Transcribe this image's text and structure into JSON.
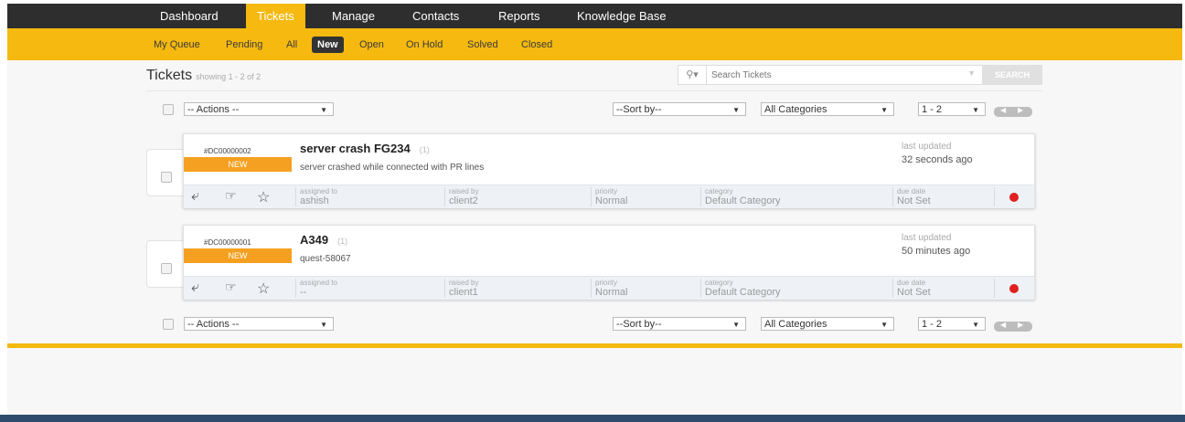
{
  "topnav": {
    "tabs": [
      {
        "label": "Dashboard"
      },
      {
        "label": "Tickets"
      },
      {
        "label": "Manage"
      },
      {
        "label": "Contacts"
      },
      {
        "label": "Reports"
      },
      {
        "label": "Knowledge Base"
      }
    ],
    "active": "Tickets"
  },
  "subnav": {
    "items": [
      {
        "label": "My Queue"
      },
      {
        "label": "Pending"
      },
      {
        "label": "All"
      },
      {
        "label": "New"
      },
      {
        "label": "Open"
      },
      {
        "label": "On Hold"
      },
      {
        "label": "Solved"
      },
      {
        "label": "Closed"
      }
    ],
    "active": "New"
  },
  "header": {
    "title": "Tickets",
    "subtitle": "showing 1 - 2 of 2"
  },
  "search": {
    "placeholder": "Search Tickets",
    "button": "SEARCH"
  },
  "toolbar": {
    "actions": "-- Actions --",
    "sort": "--Sort by--",
    "category": "All Categories",
    "range": "1 - 2"
  },
  "tickets": [
    {
      "id": "#DC00000002",
      "status": "NEW",
      "subject": "server crash FG234",
      "count": "(1)",
      "description": "server crashed while connected with PR lines",
      "last_updated_label": "last updated",
      "last_updated": "32 seconds ago",
      "assigned_label": "assigned to",
      "assigned": "ashish",
      "raised_label": "raised by",
      "raised": "client2",
      "priority_label": "priority",
      "priority": "Normal",
      "category_label": "category",
      "category": "Default Category",
      "due_label": "due date",
      "due": "Not Set"
    },
    {
      "id": "#DC00000001",
      "status": "NEW",
      "subject": "A349",
      "count": "(1)",
      "description": "quest-58067",
      "last_updated_label": "last updated",
      "last_updated": "50 minutes ago",
      "assigned_label": "assigned to",
      "assigned": "--",
      "raised_label": "raised by",
      "raised": "client1",
      "priority_label": "priority",
      "priority": "Normal",
      "category_label": "category",
      "category": "Default Category",
      "due_label": "due date",
      "due": "Not Set"
    }
  ],
  "icons": {
    "search": "search-icon",
    "reply": "reply-icon",
    "assign": "assign-hand-icon",
    "star": "star-icon",
    "status_dot": "status-dot-icon"
  },
  "colors": {
    "nav_bg": "#2e2e2e",
    "accent": "#f5b910",
    "badge_new": "#f5a020",
    "status_dot": "#e02020"
  }
}
